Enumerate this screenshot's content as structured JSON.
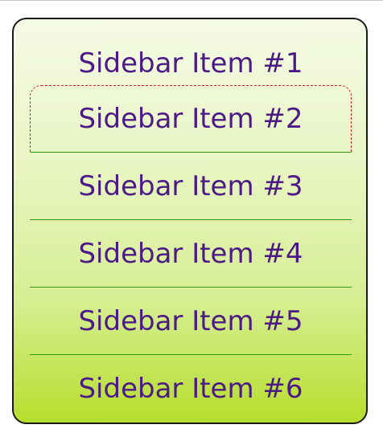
{
  "sidebar": {
    "items": [
      {
        "label": "Sidebar Item #1"
      },
      {
        "label": "Sidebar Item #2"
      },
      {
        "label": "Sidebar Item #3"
      },
      {
        "label": "Sidebar Item #4"
      },
      {
        "label": "Sidebar Item #5"
      },
      {
        "label": "Sidebar Item #6"
      }
    ]
  },
  "colors": {
    "text": "#4b1a86",
    "divider": "#2e9b10",
    "focus_outline": "#e02020",
    "gradient_top": "#f5fbe6",
    "gradient_bottom": "#b6de2c",
    "border": "#1a1a1a"
  }
}
